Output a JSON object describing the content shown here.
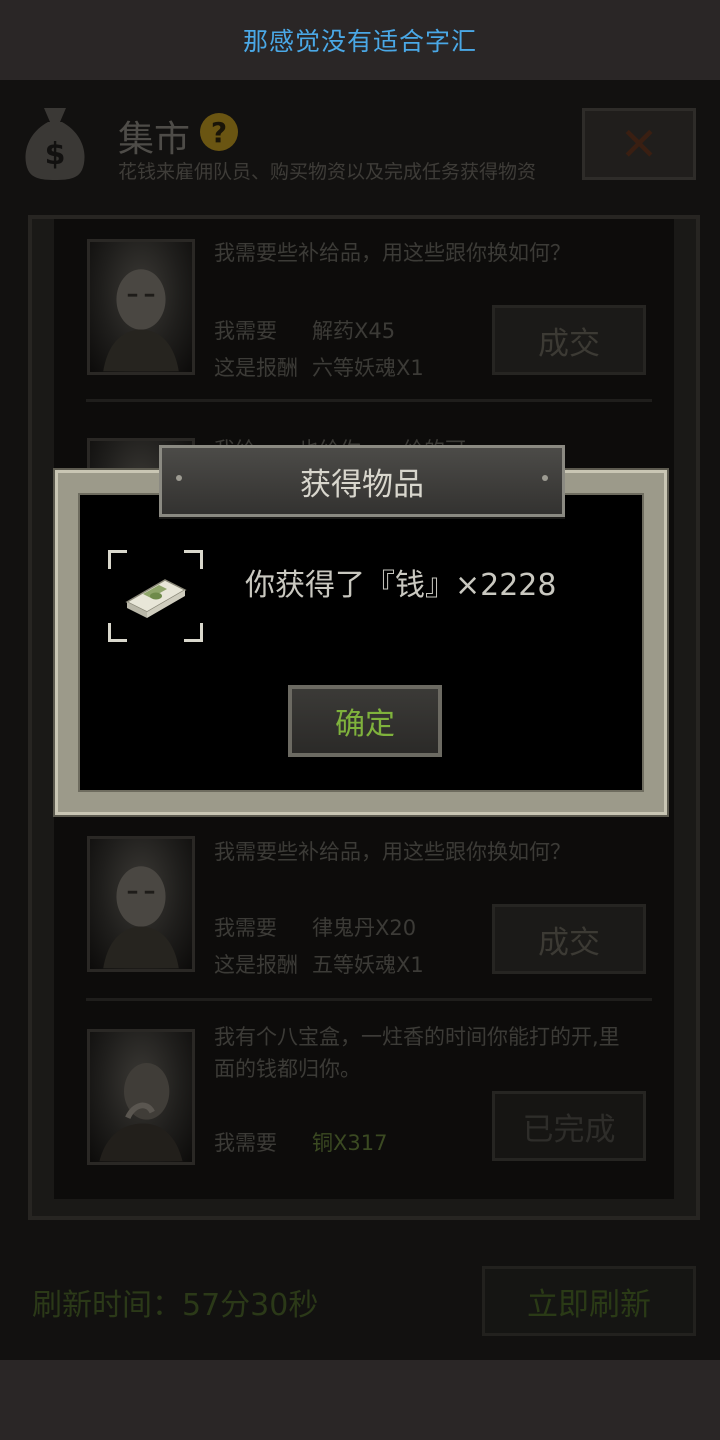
{
  "topbar": {
    "title": "那感觉没有适合字汇"
  },
  "header": {
    "title": "集市",
    "help_glyph": "?",
    "subtitle": "花钱来雇佣队员、购买物资以及完成任务获得物资",
    "close_glyph": "✕"
  },
  "rows": [
    {
      "offer": "我需要些补给品，用这些跟你换如何？",
      "need_label": "我需要",
      "need_value": "解药X45",
      "reward_label": "这是报酬",
      "reward_value": "六等妖魂X1",
      "button": "成交"
    },
    {
      "offer": "我给……也给你……给的可"
    },
    {
      "offer": "我需要些补给品，用这些跟你换如何？",
      "need_label": "我需要",
      "need_value": "律鬼丹X20",
      "reward_label": "这是报酬",
      "reward_value": "五等妖魂X1",
      "button": "成交"
    },
    {
      "offer_line1": "我有个八宝盒，一炷香的时间你能打的开,里",
      "offer_line2": "面的钱都归你。",
      "need_label": "我需要",
      "need_value": "铜X317",
      "button": "已完成"
    }
  ],
  "footer": {
    "refresh_time": "刷新时间：57分30秒",
    "refresh_button": "立即刷新"
  },
  "modal": {
    "title": "获得物品",
    "message": "你获得了『钱』×2228",
    "ok_button": "确定",
    "item_icon": "money-stack-icon"
  },
  "colors": {
    "topbar_title": "#4aa8e6",
    "confirm_text": "#7fb23c",
    "modal_frame": "#9c9a8a"
  }
}
